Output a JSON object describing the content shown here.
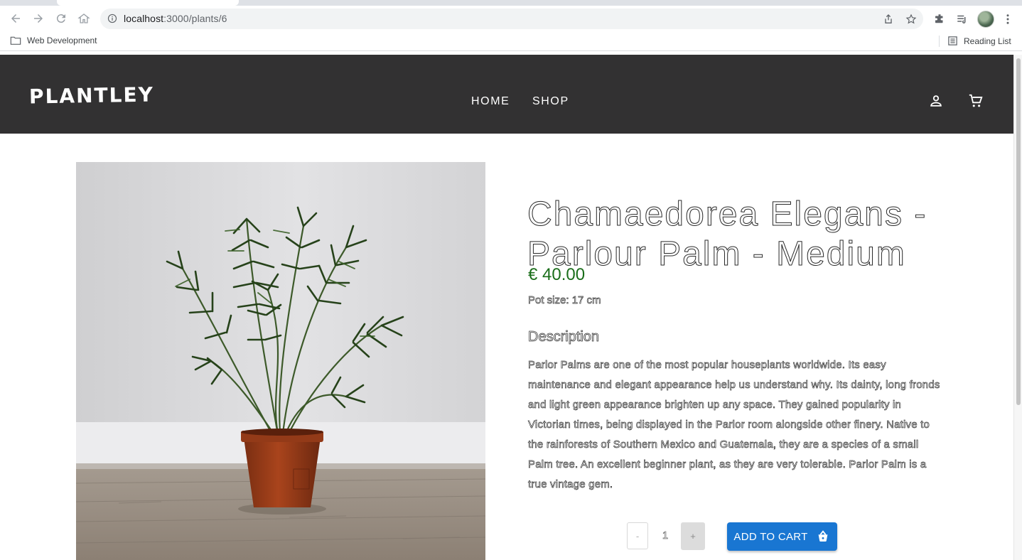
{
  "browser": {
    "url_host": "localhost",
    "url_path": ":3000/plants/6",
    "bookmarks": {
      "folder_label": "Web Development",
      "reading_list_label": "Reading List"
    }
  },
  "site": {
    "logo": "PLANTLEY",
    "nav": {
      "home": "HOME",
      "shop": "SHOP"
    }
  },
  "product": {
    "title": "Chamaedorea Elegans - Parlour Palm - Medium",
    "price": "€ 40.00",
    "pot_size": "Pot size: 17 cm",
    "description_heading": "Description",
    "description": "Parlor Palms are one of the most popular houseplants worldwide. Its easy maintenance and elegant appearance help us understand why. Its dainty, long fronds and light green appearance brighten up any space. They gained popularity in Victorian times, being displayed in the Parlor room alongside other finery. Native to the rainforests of Southern Mexico and Guatemala, they are a species of a small Palm tree. An excellent beginner plant, as they are very tolerable. Parlor Palm is a true vintage gem.",
    "quantity": {
      "minus": "-",
      "value": "1",
      "plus": "+"
    },
    "add_to_cart": "ADD TO CART"
  },
  "colors": {
    "header_bg": "#323132",
    "price": "#1b6e1b",
    "accent": "#1976d2"
  },
  "icons": [
    "back-icon",
    "forward-icon",
    "reload-icon",
    "home-icon",
    "info-icon",
    "share-icon",
    "star-icon",
    "extensions-icon",
    "media-icon",
    "menu-icon",
    "folder-icon",
    "reading-list-icon",
    "account-icon",
    "cart-icon",
    "basket-icon"
  ]
}
